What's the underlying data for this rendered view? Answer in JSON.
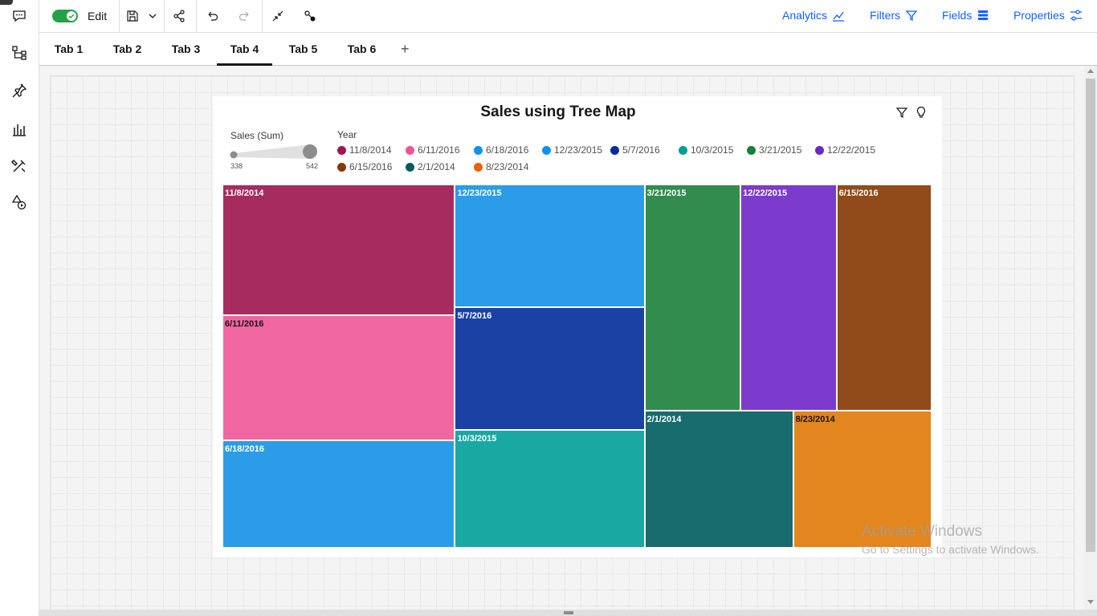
{
  "toolbar": {
    "edit_label": "Edit",
    "right_links": [
      {
        "label": "Analytics",
        "icon": "analytics-icon"
      },
      {
        "label": "Filters",
        "icon": "filter-icon"
      },
      {
        "label": "Fields",
        "icon": "fields-icon"
      },
      {
        "label": "Properties",
        "icon": "properties-icon"
      }
    ],
    "accent_color": "#0f62fe",
    "toggle_color": "#24a148"
  },
  "tabs": [
    {
      "label": "Tab 1",
      "active": false
    },
    {
      "label": "Tab 2",
      "active": false
    },
    {
      "label": "Tab 3",
      "active": false
    },
    {
      "label": "Tab 4",
      "active": true
    },
    {
      "label": "Tab 5",
      "active": false
    },
    {
      "label": "Tab 6",
      "active": false
    }
  ],
  "tab_add_label": "+",
  "widget": {
    "size_legend": {
      "title": "Sales (Sum)",
      "min": "338",
      "max": "542"
    },
    "color_legend_title": "Year"
  },
  "chart_data": {
    "type": "treemap",
    "title": "Sales using Tree Map",
    "size_measure": "Sales (Sum)",
    "color_dimension": "Year",
    "legend_placement": "top-left",
    "categories": [
      "11/8/2014",
      "6/11/2016",
      "6/18/2016",
      "12/23/2015",
      "5/7/2016",
      "10/3/2015",
      "3/21/2015",
      "12/22/2015",
      "6/15/2016",
      "2/1/2014",
      "8/23/2014"
    ],
    "values": [
      542,
      517,
      443,
      414,
      414,
      397,
      386,
      386,
      382,
      363,
      338
    ],
    "colors": [
      "#a62c60",
      "#ef66a0",
      "#2b9ce8",
      "#2b9ce8",
      "#1a41a4",
      "#1aa8a3",
      "#328c4e",
      "#7c3bcc",
      "#914a1a",
      "#196c6d",
      "#e2861d"
    ],
    "label_colors": [
      "#ffffff",
      "#161616",
      "#ffffff",
      "#ffffff",
      "#ffffff",
      "#ffffff",
      "#ffffff",
      "#ffffff",
      "#ffffff",
      "#ffffff",
      "#161616"
    ]
  },
  "legend_colors": [
    "#9f1853",
    "#ee5396",
    "#1192e8",
    "#1192e8",
    "#002d9c",
    "#009d9a",
    "#198038",
    "#6929c4",
    "#8a3800",
    "#005d5d",
    "#eb6200"
  ],
  "watermark": {
    "line1": "Activate Windows",
    "line2": "Go to Settings to activate Windows."
  }
}
